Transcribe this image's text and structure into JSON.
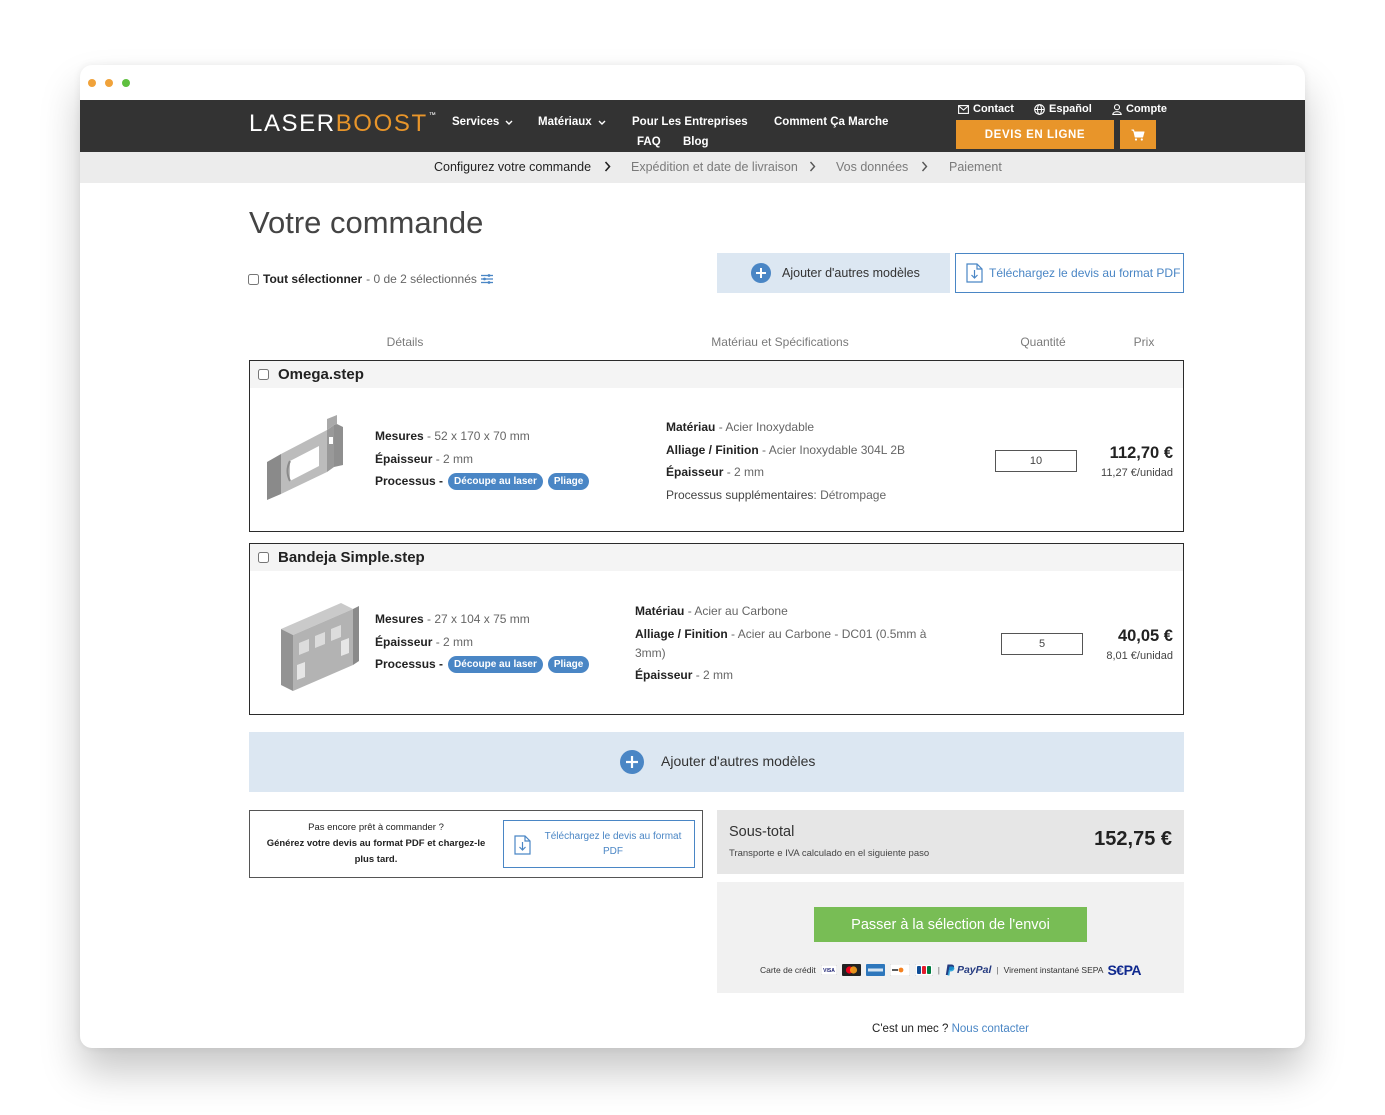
{
  "colors": {
    "brand_orange": "#e8952a",
    "link_blue": "#4a86c5",
    "header_bg": "#333333",
    "checkout_green": "#78bd55",
    "add_bar_bg": "#dce7f2",
    "traffic_dots": [
      "#f0a23a",
      "#f0a23a",
      "#5fc03f"
    ]
  },
  "header": {
    "logo": {
      "part1": "LASER",
      "part2": "BOOST",
      "tm": "™"
    },
    "nav": [
      "Services",
      "Matériaux",
      "Pour Les Entreprises",
      "Comment Ça Marche"
    ],
    "nav_row2": [
      "FAQ",
      "Blog"
    ],
    "top_links": [
      "Contact",
      "Español",
      "Compte"
    ],
    "cta": "DEVIS EN LIGNE"
  },
  "breadcrumb": [
    "Configurez votre commande",
    "Expédition et date de livraison",
    "Vos données",
    "Paiement"
  ],
  "page": {
    "title": "Votre commande"
  },
  "selection": {
    "label": "Tout sélectionner",
    "status": "- 0 de 2 sélectionnés"
  },
  "actions": {
    "add_models": "Ajouter d'autres modèles",
    "download_pdf": "Téléchargez le devis au format PDF"
  },
  "table_headers": {
    "details": "Détails",
    "material": "Matériau et Spécifications",
    "quantity": "Quantité",
    "price": "Prix"
  },
  "items": [
    {
      "name": "Omega.step",
      "details": [
        {
          "label": "Mesures",
          "value": "52 x 170 x 70 mm"
        },
        {
          "label": "Épaisseur",
          "value": "2 mm"
        }
      ],
      "process_label": "Processus",
      "processes": [
        "Découpe au laser",
        "Pliage"
      ],
      "specs": [
        {
          "label": "Matériau",
          "value": "Acier Inoxydable"
        },
        {
          "label": "Alliage / Finition",
          "value": "Acier Inoxydable 304L 2B"
        },
        {
          "label": "Épaisseur",
          "value": "2 mm"
        },
        {
          "label": "Processus supplémentaires",
          "value": "Détrompage"
        }
      ],
      "quantity": "10",
      "price": "112,70 €",
      "unit_price": "11,27 €/unidad"
    },
    {
      "name": "Bandeja Simple.step",
      "details": [
        {
          "label": "Mesures",
          "value": "27 x 104 x 75 mm"
        },
        {
          "label": "Épaisseur",
          "value": "2 mm"
        }
      ],
      "process_label": "Processus",
      "processes": [
        "Découpe au laser",
        "Pliage"
      ],
      "specs": [
        {
          "label": "Matériau",
          "value": "Acier au Carbone"
        },
        {
          "label": "Alliage / Finition",
          "value": "Acier au Carbone - DC01 (0.5mm à 3mm)"
        },
        {
          "label": "Épaisseur",
          "value": "2 mm"
        }
      ],
      "quantity": "5",
      "price": "40,05 €",
      "unit_price": "8,01 €/unidad"
    }
  ],
  "add_models_bar": "Ajouter d'autres modèles",
  "pdf_box": {
    "line1": "Pas encore prêt à commander ?",
    "line2": "Générez votre devis au format PDF et chargez-le plus tard.",
    "button": "Téléchargez le devis au format PDF"
  },
  "subtotal": {
    "label": "Sous-total",
    "note": "Transporte e IVA calculado en el siguiente paso",
    "amount": "152,75 €"
  },
  "checkout": {
    "button": "Passer à la sélection de l'envoi",
    "payment": {
      "card_label": "Carte de crédit",
      "card_icons": [
        "visa-icon",
        "mastercard-icon",
        "amex-icon",
        "discover-icon",
        "jcb-icon"
      ],
      "paypal": "PayPal",
      "sepa_label": "Virement instantané SEPA",
      "sepa_logo": "S€PA"
    }
  },
  "footer": {
    "question": "C'est un mec ?",
    "link": "Nous contacter"
  }
}
